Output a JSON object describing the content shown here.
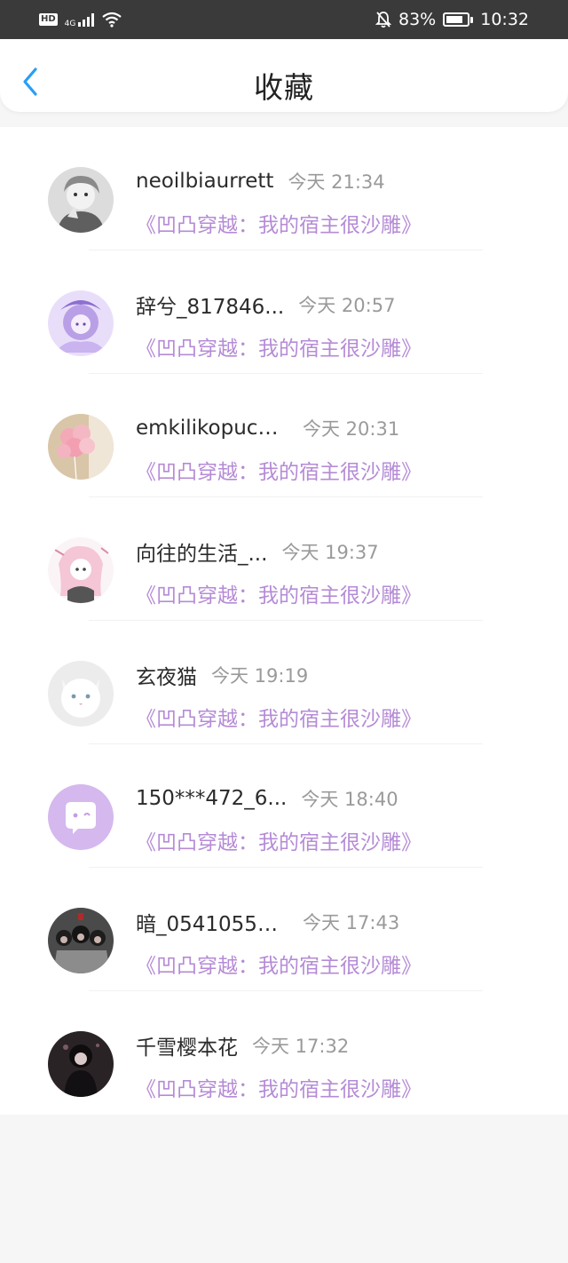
{
  "status_bar": {
    "hd": "HD",
    "network": "4G",
    "battery_percent": "83%",
    "battery_level": 0.83,
    "time": "10:32",
    "icons": [
      "signal-icon",
      "wifi-icon",
      "bell-off-icon",
      "battery-icon"
    ]
  },
  "header": {
    "title": "收藏",
    "back_icon": "chevron-left-icon",
    "accent_color": "#2a9df4"
  },
  "work_color": "#b58bd6",
  "favorites": [
    {
      "username": "neoilbiaurrett",
      "time": "今天 21:34",
      "work": "《凹凸穿越：我的宿主很沙雕》"
    },
    {
      "username": "辞兮_817846...",
      "time": "今天 20:57",
      "work": "《凹凸穿越：我的宿主很沙雕》"
    },
    {
      "username": "emkilikopuce...",
      "time": "今天 20:31",
      "work": "《凹凸穿越：我的宿主很沙雕》"
    },
    {
      "username": "向往的生活_...",
      "time": "今天 19:37",
      "work": "《凹凸穿越：我的宿主很沙雕》"
    },
    {
      "username": "玄夜猫",
      "time": "今天 19:19",
      "work": "《凹凸穿越：我的宿主很沙雕》"
    },
    {
      "username": "150***472_6...",
      "time": "今天 18:40",
      "work": "《凹凸穿越：我的宿主很沙雕》"
    },
    {
      "username": "暗_05410559...",
      "time": "今天 17:43",
      "work": "《凹凸穿越：我的宿主很沙雕》"
    },
    {
      "username": "千雪樱本花",
      "time": "今天 17:32",
      "work": "《凹凸穿越：我的宿主很沙雕》"
    }
  ]
}
